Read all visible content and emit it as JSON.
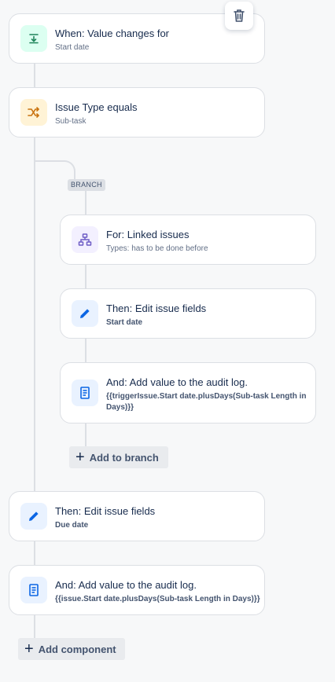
{
  "trigger": {
    "title": "When: Value changes for",
    "subtitle": "Start date",
    "icon": "field-change-icon",
    "delete_icon": "trash-icon"
  },
  "condition": {
    "title": "Issue Type equals",
    "subtitle": "Sub-task",
    "icon": "shuffle-icon"
  },
  "branch": {
    "badge": "BRANCH",
    "for_card": {
      "title": "For: Linked issues",
      "subtitle": "Types: has to be done before",
      "icon": "hierarchy-icon"
    },
    "edit_card": {
      "title": "Then: Edit issue fields",
      "subtitle": "Start date",
      "icon": "pencil-icon"
    },
    "audit_card": {
      "title": "And: Add value to the audit log.",
      "subtitle_line1": "{{triggerIssue.Start date.plusDays(Sub-task Length in",
      "subtitle_line2": "Days)}}",
      "icon": "document-icon"
    },
    "add_button": "Add to branch"
  },
  "edit_card": {
    "title": "Then: Edit issue fields",
    "subtitle": "Due date",
    "icon": "pencil-icon"
  },
  "audit_card": {
    "title": "And: Add value to the audit log.",
    "subtitle": "{{issue.Start date.plusDays(Sub-task Length in Days)}}",
    "icon": "document-icon"
  },
  "add_component": "Add component",
  "colors": {
    "connector": "#dcdfe4",
    "card_border": "#dcdfe4",
    "trigger_bg": "#dcfff1",
    "trigger_fg": "#1f845a",
    "condition_bg": "#fff3d6",
    "condition_fg": "#c9720e",
    "branch_bg": "#f3f0ff",
    "branch_fg": "#6e5dc6",
    "action_bg": "#e9f2ff",
    "action_fg": "#0c66e4"
  }
}
